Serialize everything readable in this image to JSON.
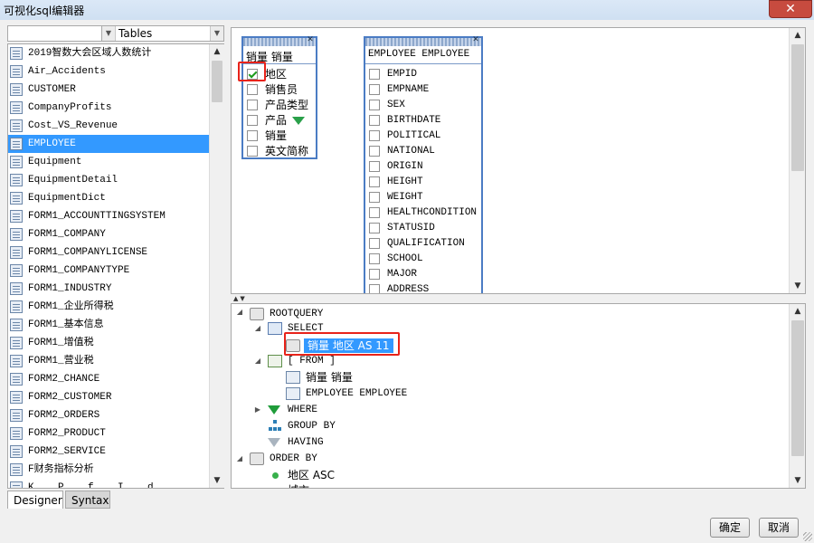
{
  "window": {
    "title": "可视化sql编辑器",
    "close_glyph": "✕"
  },
  "left_panel": {
    "search_placeholder": "",
    "combo_value": "Tables",
    "tables": [
      "2019智数大会区域人数统计",
      "Air_Accidents",
      "CUSTOMER",
      "CompanyProfits",
      "Cost_VS_Revenue",
      "EMPLOYEE",
      "Equipment",
      "EquipmentDetail",
      "EquipmentDict",
      "FORM1_ACCOUNTTINGSYSTEM",
      "FORM1_COMPANY",
      "FORM1_COMPANYLICENSE",
      "FORM1_COMPANYTYPE",
      "FORM1_INDUSTRY",
      "FORM1_企业所得税",
      "FORM1_基本信息",
      "FORM1_增值税",
      "FORM1_营业税",
      "FORM2_CHANCE",
      "FORM2_CUSTOMER",
      "FORM2_ORDERS",
      "FORM2_PRODUCT",
      "FORM2_SERVICE",
      "F财务指标分析",
      "K... P... f... I... d..."
    ],
    "selected_table": "EMPLOYEE",
    "tabs": [
      "Designer",
      "Syntax"
    ]
  },
  "canvas": {
    "sales_table": {
      "name": "销量 销量",
      "fields": [
        {
          "label": "地区",
          "checked": true
        },
        {
          "label": "销售员",
          "checked": false
        },
        {
          "label": "产品类型",
          "checked": false
        },
        {
          "label": "产品",
          "checked": false,
          "filter": true
        },
        {
          "label": "销量",
          "checked": false
        },
        {
          "label": "英文简称",
          "checked": false
        }
      ]
    },
    "employee_table": {
      "name": "EMPLOYEE EMPLOYEE",
      "fields": [
        "EMPID",
        "EMPNAME",
        "SEX",
        "BIRTHDATE",
        "POLITICAL",
        "NATIONAL",
        "ORIGIN",
        "HEIGHT",
        "WEIGHT",
        "HEALTHCONDITION",
        "STATUSID",
        "QUALIFICATION",
        "SCHOOL",
        "MAJOR",
        "ADDRESS"
      ]
    }
  },
  "tree": {
    "root": "ROOTQUERY",
    "select": "SELECT",
    "select_item": "销量 地区 AS 11",
    "from": "[ FROM ]",
    "from_items": [
      "销量 销量",
      "EMPLOYEE EMPLOYEE"
    ],
    "where": "WHERE",
    "group_by": "GROUP BY",
    "having": "HAVING",
    "order_by": "ORDER BY",
    "order_item": "地区 ASC",
    "partial_item": "城市"
  },
  "buttons": {
    "ok": "确定",
    "cancel": "取消"
  },
  "colors": {
    "selection": "#3399ff",
    "highlight_border": "#e8231a",
    "check": "#1c9b1c",
    "filter": "#2aa04a"
  }
}
